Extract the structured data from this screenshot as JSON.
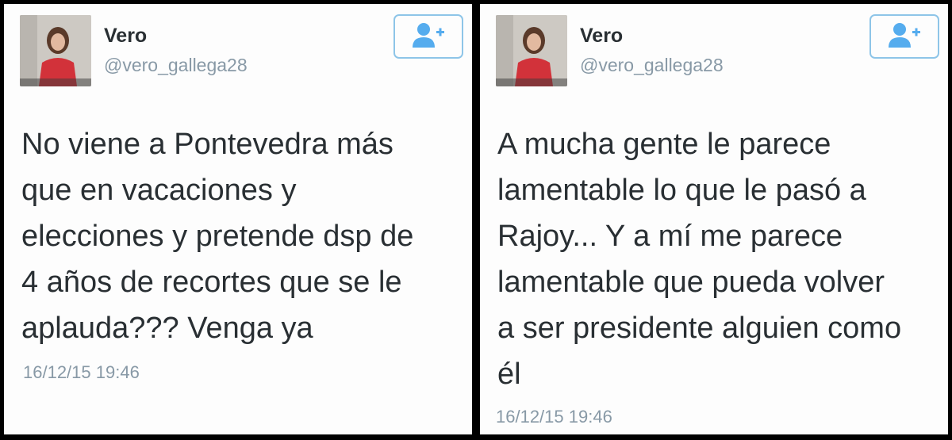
{
  "accent_color": "#55acee",
  "tweets": [
    {
      "display_name": "Vero",
      "handle": "@vero_gallega28",
      "text": "No viene a Pontevedra más\nque en vacaciones y\nelecciones y pretende dsp de\n4 años de recortes que se le\naplauda??? Venga ya",
      "timestamp": "16/12/15 19:46",
      "follow_icon": "add-user-icon"
    },
    {
      "display_name": "Vero",
      "handle": "@vero_gallega28",
      "text": "A mucha gente le parece\nlamentable lo que le pasó a\nRajoy... Y a mí me parece\nlamentable que pueda volver\na ser presidente alguien como\nél",
      "timestamp": "16/12/15 19:46",
      "follow_icon": "add-user-icon"
    }
  ]
}
